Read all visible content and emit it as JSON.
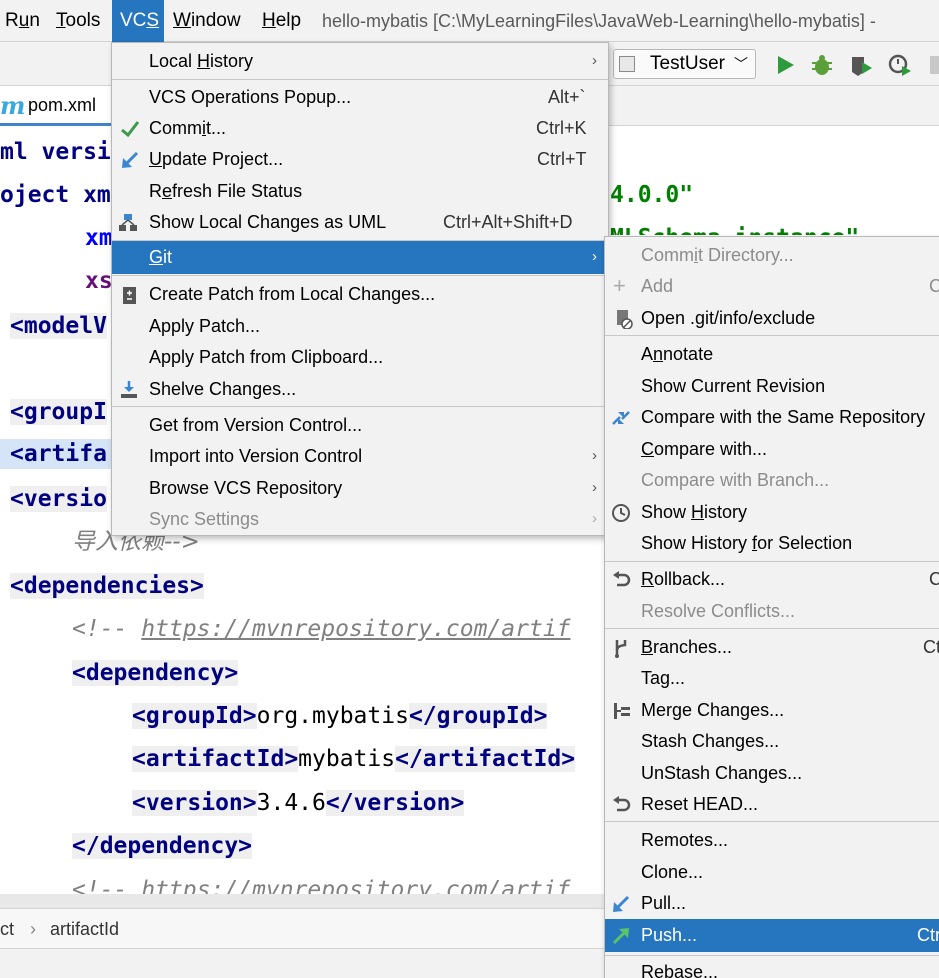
{
  "menubar": {
    "items": [
      {
        "pre": "R",
        "u": "u",
        "post": "n"
      },
      {
        "pre": "",
        "u": "T",
        "post": "ools"
      },
      {
        "pre": "VC",
        "u": "S",
        "post": ""
      },
      {
        "pre": "",
        "u": "W",
        "post": "indow"
      },
      {
        "pre": "",
        "u": "H",
        "post": "elp"
      }
    ],
    "title": "hello-mybatis [C:\\MyLearningFiles\\JavaWeb-Learning\\hello-mybatis] -"
  },
  "toolbar": {
    "run_config": "TestUser",
    "buttons": [
      "run-icon",
      "debug-icon",
      "coverage-icon",
      "profile-icon",
      "stop-icon"
    ]
  },
  "tabs": [
    {
      "label": "pom.xml",
      "icon": "maven-icon"
    }
  ],
  "editor": {
    "line1": {
      "a": "ml versi"
    },
    "line2": {
      "a": "oject xm",
      "b": "4.0.0\""
    },
    "line3": {
      "a": "xm",
      "b": "MLSchema-instance\""
    },
    "line4": {
      "a": "xs"
    },
    "line5": {
      "a": "<modelV"
    },
    "line6": {
      "a": "<groupI"
    },
    "line7": {
      "a": "<artifa"
    },
    "line8": {
      "a": "<versio"
    },
    "line9": {
      "a": "导入依赖-->"
    },
    "line10": {
      "a": "<dependencies>"
    },
    "line11": {
      "open": "<!-- ",
      "link": "https://mvnrepository.com/artif"
    },
    "line12": {
      "a": "<dependency>"
    },
    "line13": {
      "t1": "<groupId>",
      "v": "org.mybatis",
      "t2": "</groupId>"
    },
    "line14": {
      "t1": "<artifactId>",
      "v": "mybatis",
      "t2": "</artifactId>"
    },
    "line15": {
      "t1": "<version>",
      "v": "3.4.6",
      "t2": "</version>"
    },
    "line16": {
      "a": "</dependency>"
    },
    "line17": {
      "open": "<!-- ",
      "link": "https://mvnrepository.com/artif"
    }
  },
  "breadcrumb": {
    "parent": "ct",
    "sep": "›",
    "current": "artifactId"
  },
  "vcs_menu": {
    "items": [
      {
        "pre": "Local ",
        "u": "H",
        "post": "istory",
        "shortcut": "",
        "submenu": true
      },
      {
        "pre": "VCS Operations Popup...",
        "u": "",
        "post": "",
        "shortcut": "Alt+`"
      },
      {
        "pre": "Comm",
        "u": "i",
        "post": "t...",
        "shortcut": "Ctrl+K",
        "icon": "commit-check-icon"
      },
      {
        "pre": "",
        "u": "U",
        "post": "pdate Project...",
        "shortcut": "Ctrl+T",
        "icon": "update-arrow-icon"
      },
      {
        "pre": "R",
        "u": "e",
        "post": "fresh File Status",
        "shortcut": ""
      },
      {
        "pre": "Show Local Changes as UML",
        "u": "",
        "post": "",
        "shortcut": "Ctrl+Alt+Shift+D",
        "icon": "uml-icon"
      },
      {
        "pre": "",
        "u": "G",
        "post": "it",
        "shortcut": "",
        "submenu": true
      },
      {
        "pre": "Create Patch from Local Changes...",
        "u": "",
        "post": "",
        "shortcut": "",
        "icon": "patch-icon"
      },
      {
        "pre": "Apply Patch...",
        "u": "",
        "post": "",
        "shortcut": ""
      },
      {
        "pre": "Apply Patch from Clipboard...",
        "u": "",
        "post": "",
        "shortcut": ""
      },
      {
        "pre": "Shelve Changes...",
        "u": "",
        "post": "",
        "shortcut": "",
        "icon": "shelve-icon"
      },
      {
        "pre": "Get from Version Control...",
        "u": "",
        "post": "",
        "shortcut": ""
      },
      {
        "pre": "Import into Version Control",
        "u": "",
        "post": "",
        "shortcut": "",
        "submenu": true
      },
      {
        "pre": "Browse VCS Repository",
        "u": "",
        "post": "",
        "shortcut": "",
        "submenu": true
      },
      {
        "pre": "Sync Settings",
        "u": "",
        "post": "",
        "shortcut": "",
        "submenu": true,
        "disabled": true
      }
    ]
  },
  "git_menu": {
    "items": [
      {
        "pre": "Comm",
        "u": "i",
        "post": "t Directory...",
        "shortcut": "",
        "disabled": true
      },
      {
        "pre": "Add",
        "u": "",
        "post": "",
        "shortcut": "C",
        "disabled": true,
        "icon": "plus-icon"
      },
      {
        "pre": "Open .git/info/exclude",
        "u": "",
        "post": "",
        "shortcut": "",
        "icon": "git-file-icon"
      },
      {
        "pre": "A",
        "u": "n",
        "post": "notate",
        "shortcut": ""
      },
      {
        "pre": "Show Current Revision",
        "u": "",
        "post": "",
        "shortcut": ""
      },
      {
        "pre": "Compare with the Same Repository",
        "u": "",
        "post": "",
        "shortcut": "",
        "icon": "compare-icon"
      },
      {
        "pre": "",
        "u": "C",
        "post": "ompare with...",
        "shortcut": ""
      },
      {
        "pre": "Compare with Branch...",
        "u": "",
        "post": "",
        "shortcut": "",
        "disabled": true
      },
      {
        "pre": "Show ",
        "u": "H",
        "post": "istory",
        "shortcut": "",
        "icon": "history-clock-icon"
      },
      {
        "pre": "Show History ",
        "u": "f",
        "post": "or Selection",
        "shortcut": ""
      },
      {
        "pre": "",
        "u": "R",
        "post": "ollback...",
        "shortcut": "C",
        "icon": "rollback-icon"
      },
      {
        "pre": "Resolve Conflicts...",
        "u": "",
        "post": "",
        "shortcut": "",
        "disabled": true
      },
      {
        "pre": "",
        "u": "B",
        "post": "ranches...",
        "shortcut": "Ct",
        "icon": "branch-icon"
      },
      {
        "pre": "Tag...",
        "u": "",
        "post": "",
        "shortcut": ""
      },
      {
        "pre": "Merge Changes...",
        "u": "",
        "post": "",
        "shortcut": "",
        "icon": "merge-icon"
      },
      {
        "pre": "Stash Changes...",
        "u": "",
        "post": "",
        "shortcut": ""
      },
      {
        "pre": "UnStash Changes...",
        "u": "",
        "post": "",
        "shortcut": ""
      },
      {
        "pre": "Reset HEAD...",
        "u": "",
        "post": "",
        "shortcut": "",
        "icon": "reset-icon"
      },
      {
        "pre": "Remotes...",
        "u": "",
        "post": "",
        "shortcut": ""
      },
      {
        "pre": "Clone...",
        "u": "",
        "post": "",
        "shortcut": ""
      },
      {
        "pre": "Pull...",
        "u": "",
        "post": "",
        "shortcut": "",
        "icon": "pull-arrow-icon"
      },
      {
        "pre": "Push...",
        "u": "",
        "post": "",
        "shortcut": "Ctr",
        "icon": "push-arrow-icon"
      },
      {
        "pre": "Rebase...",
        "u": "",
        "post": "",
        "shortcut": ""
      }
    ]
  },
  "colors": {
    "selection": "#2675bf",
    "menu_bg": "#f2f2f2",
    "xml_tag": "#000080",
    "xml_string": "#008000"
  }
}
